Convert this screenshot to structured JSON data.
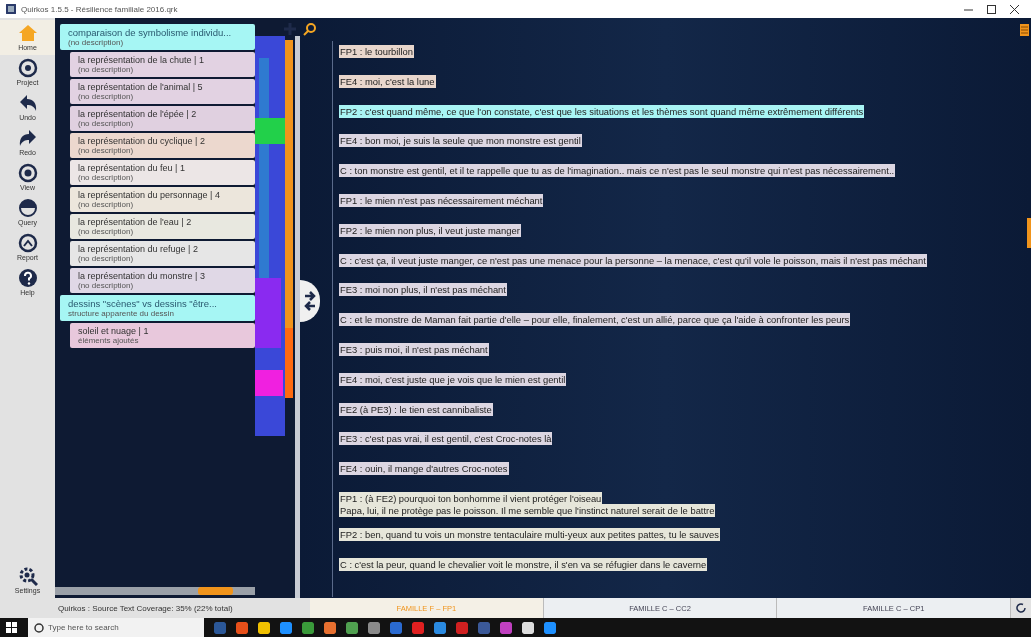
{
  "window": {
    "title": "Quirkos 1.5.5 - Résilience familiale 2016.qrk"
  },
  "toolbar": [
    {
      "label": "Home",
      "selected": true
    },
    {
      "label": "Project",
      "selected": false
    },
    {
      "label": "Undo",
      "selected": false
    },
    {
      "label": "Redo",
      "selected": false
    },
    {
      "label": "View",
      "selected": false
    },
    {
      "label": "Query",
      "selected": false
    },
    {
      "label": "Report",
      "selected": false
    },
    {
      "label": "Help",
      "selected": false
    }
  ],
  "settings": {
    "label": "Settings"
  },
  "codes": [
    {
      "label": "comparaison de symbolisme individu...",
      "description": "(no description)",
      "color": "#a6f6f4",
      "children": [
        {
          "label": "la représentation de la chute | 1",
          "description": "(no description)",
          "color": "#e2d2e2"
        },
        {
          "label": "la représentation de l'animal | 5",
          "description": "(no description)",
          "color": "#e2d2e2"
        },
        {
          "label": "la représentation de l'épée | 2",
          "description": "(no description)",
          "color": "#e0d0e0"
        },
        {
          "label": "la représentation du cyclique | 2",
          "description": "(no description)",
          "color": "#ecd8ce"
        },
        {
          "label": "la représentation du feu | 1",
          "description": "(no description)",
          "color": "#ece6e6"
        },
        {
          "label": "la représentation du personnage | 4",
          "description": "(no description)",
          "color": "#ece6dc"
        },
        {
          "label": "la représentation de l'eau | 2",
          "description": "(no description)",
          "color": "#e8e8e0"
        },
        {
          "label": "la représentation du refuge | 2",
          "description": "(no description)",
          "color": "#e6e6e6"
        },
        {
          "label": "la représentation du monstre | 3",
          "description": "(no description)",
          "color": "#e0d8e6"
        }
      ]
    },
    {
      "label": "dessins \"scènes\" vs dessins \"être...",
      "description": "structure apparente du dessin",
      "color": "#a6f6f4",
      "children": [
        {
          "label": "soleil et nuage | 1",
          "description": "éléments ajoutés",
          "color": "#e8c8dc"
        }
      ]
    }
  ],
  "transcript": [
    {
      "lines": [
        "FP1 : le tourbillon"
      ],
      "color": "#e8d6cc"
    },
    {
      "lines": [
        "FE4 : moi, c'est la lune"
      ],
      "color": "#e8d6cc"
    },
    {
      "lines": [
        "FP2 : c'est quand même, ce que l'on constate, c'est que les situations et les thèmes sont quand même extrêmement différents"
      ],
      "color": "#a8f4f4"
    },
    {
      "lines": [
        "FE4 : bon moi, je suis la seule que mon monstre est gentil"
      ],
      "color": "#dcd6e2"
    },
    {
      "lines": [
        "C : ton monstre est gentil, et il te rappelle que tu as de l'imagination.. mais ce n'est pas le seul monstre qui n'est pas nécessairement.."
      ],
      "color": "#dcd6e2"
    },
    {
      "lines": [
        "FP1 : le mien n'est pas nécessairement méchant"
      ],
      "color": "#dcd6e2"
    },
    {
      "lines": [
        "FP2 : le mien non plus, il  veut juste manger"
      ],
      "color": "#dcd6e2"
    },
    {
      "lines": [
        "C : c'est ça, il veut juste manger, ce n'est pas une menace pour la personne – la menace, c'est qu'il vole le poisson, mais il n'est pas méchant"
      ],
      "color": "#dcd6e2"
    },
    {
      "lines": [
        "FE3 : moi non plus, il n'est pas méchant"
      ],
      "color": "#dcd6e2"
    },
    {
      "lines": [
        "C : et le monstre de Maman fait partie d'elle – pour elle, finalement, c'est un allié, parce que ça l'aide à confronter les peurs"
      ],
      "color": "#dcd6e2"
    },
    {
      "lines": [
        "FE3 : puis moi, il n'est pas méchant"
      ],
      "color": "#dcd6e2"
    },
    {
      "lines": [
        "FE4 : moi, c'est juste que je  vois que le mien est gentil"
      ],
      "color": "#dcd6e2"
    },
    {
      "lines": [
        "FE2 (à PE3) : le tien est  cannibaliste"
      ],
      "color": "#dcd6e2"
    },
    {
      "lines": [
        "FE3 :  c'est pas vrai, il est gentil, c'est  Croc-notes là"
      ],
      "color": "#dcd6e2"
    },
    {
      "lines": [
        "FE4 : ouin, il mange d'autres  Croc-notes"
      ],
      "color": "#dcd6e2"
    },
    {
      "lines": [
        "FP1 : (à FE2) pourquoi ton bonhomme il vient protéger l'oiseau",
        "Papa, lui, il ne protège pas le poisson. Il me semble que l'instinct naturel serait de le battre"
      ],
      "color": "#e6e6da"
    },
    {
      "lines": [
        "FP2 : ben, quand tu vois un monstre tentaculaire multi-yeux aux petites pattes, tu le sauves"
      ],
      "color": "#e6e6da"
    },
    {
      "lines": [
        "C : c'est la peur, quand le chevalier voit le monstre, il s'en va se réfugier dans le caverne"
      ],
      "color": "#e6e6da"
    }
  ],
  "status_bar": {
    "text": "Quirkos :  Source Text Coverage: 35% (22% total)"
  },
  "source_tabs": [
    {
      "label": "FAMILLE F – FP1",
      "selected": true
    },
    {
      "label": "FAMILLE C – CC2",
      "selected": false
    },
    {
      "label": "FAMILLE C – CP1",
      "selected": false
    }
  ],
  "taskbar": {
    "search": {
      "placeholder": "Type here to search"
    }
  }
}
